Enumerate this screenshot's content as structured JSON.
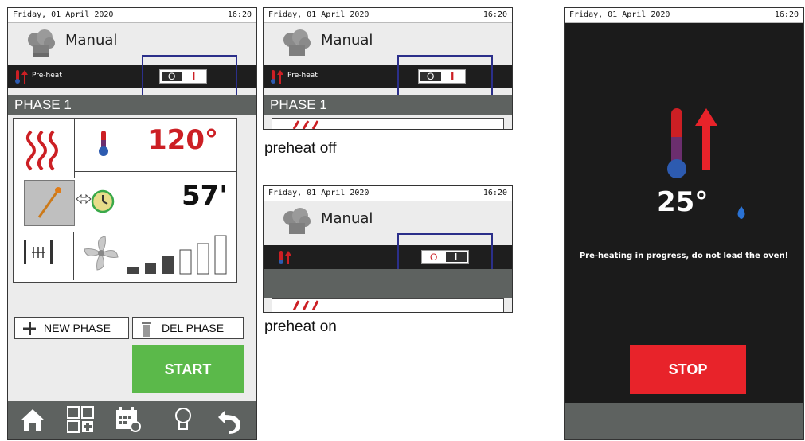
{
  "status": {
    "date": "Friday, 01 April 2020",
    "time": "16:20"
  },
  "screen1": {
    "title": "Manual",
    "preheat_label": "Pre-heat",
    "toggle": {
      "off": "O",
      "on": "I"
    },
    "phase_label": "PHASE 1",
    "temperature": "120°",
    "time": "57'",
    "new_phase": "NEW PHASE",
    "del_phase": "DEL PHASE",
    "start": "START"
  },
  "screen2": {
    "title": "Manual",
    "preheat_label": "Pre-heat",
    "toggle": {
      "off": "O",
      "on": "I"
    },
    "phase_label": "PHASE 1",
    "caption": "preheat off"
  },
  "screen3": {
    "title": "Manual",
    "toggle": {
      "off": "O",
      "on": "I"
    },
    "caption": "preheat on"
  },
  "screen4": {
    "temperature": "25°",
    "message": "Pre-heating in progress, do not load the oven!",
    "stop": "STOP"
  },
  "colors": {
    "accent_red": "#cc1f24",
    "start_green": "#5bb94a",
    "stop_red": "#e8232a",
    "highlight_blue": "#2b2f8a",
    "dark_bar": "#1e1e1e",
    "phase_gray": "#5e6260"
  },
  "icons": [
    "chef-hat-icon",
    "thermometer-up-icon",
    "heat-waves-icon",
    "thermometer-icon",
    "probe-icon",
    "clock-icon",
    "steam-valve-icon",
    "fan-icon",
    "fan-speed-bars-icon",
    "plus-icon",
    "trash-icon",
    "home-icon",
    "grid-add-icon",
    "calendar-icon",
    "lightbulb-icon",
    "back-icon",
    "water-drop-icon"
  ]
}
